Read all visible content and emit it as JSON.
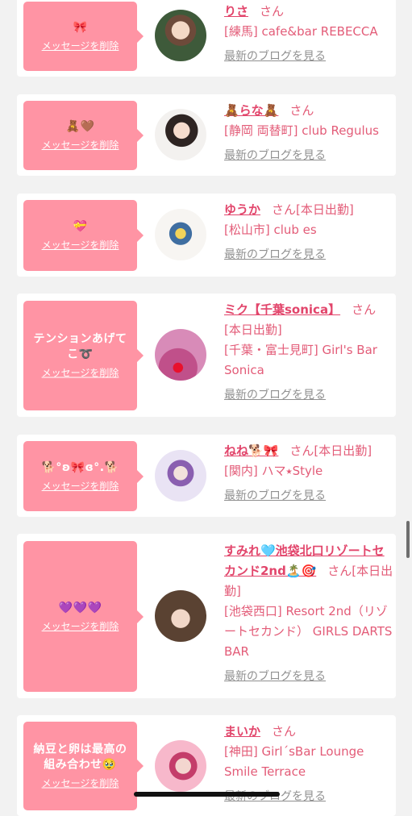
{
  "delete_label": "メッセージを削除",
  "san_label": "さん",
  "blog_label": "最新のブログを見る",
  "cards": [
    {
      "message": "🎀",
      "name": "りさ",
      "status": "",
      "shop": "[練馬] cafe&bar REBECCA"
    },
    {
      "message": "🧸🤎",
      "name": "🧸らな🧸",
      "status": "",
      "shop": "[静岡 両替町] club Regulus"
    },
    {
      "message": "💝",
      "name": "ゆうか",
      "status": "[本日出勤]",
      "shop": "[松山市] club es"
    },
    {
      "message": "テンションあげてこ➰",
      "name": "ミク【千葉sonica】",
      "status": "[本日出勤]",
      "shop": "[千葉・富士見町] Girl's Bar Sonica"
    },
    {
      "message": "🐕°ʚ🎀ɞ°.🐕",
      "name": "ねね🐕🎀",
      "status": "[本日出勤]",
      "shop": "[関内] ハマ⭑Style"
    },
    {
      "message": "💜💜💜",
      "name": "すみれ🩵池袋北口リゾートセカンド2nd🏝️🎯",
      "status": "[本日出勤]",
      "shop": "[池袋西口] Resort 2nd（リゾートセカンド） GIRLS DARTS BAR"
    },
    {
      "message": "納豆と卵は最高の組み合わせ🥹",
      "name": "まいか",
      "status": "",
      "shop": "[神田] Girl´sBar Lounge Smile Terrace"
    }
  ],
  "colors": {
    "accent": "#e2456b",
    "bubble": "#ff94a4",
    "link_gray": "#909090"
  }
}
